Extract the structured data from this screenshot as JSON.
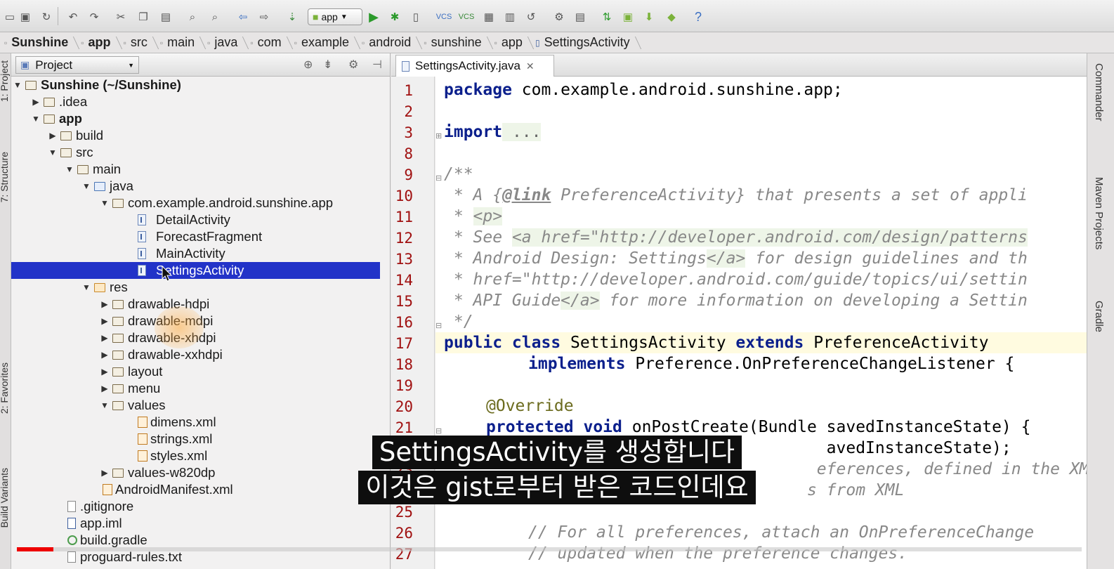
{
  "toolbar": {
    "run_config": "app"
  },
  "breadcrumbs": [
    "Sunshine",
    "app",
    "src",
    "main",
    "java",
    "com",
    "example",
    "android",
    "sunshine",
    "app",
    "SettingsActivity"
  ],
  "left_strip": {
    "project_tab": "1: Project",
    "structure_tab": "7: Structure",
    "favorites_tab": "2: Favorites",
    "build_variants_tab": "Build Variants"
  },
  "right_strip": {
    "commander_tab": "Commander",
    "maven_tab": "Maven Projects",
    "gradle_tab": "Gradle"
  },
  "project_panel": {
    "title": "Project"
  },
  "tree": [
    {
      "label": "Sunshine (~/Sunshine)",
      "arrow": "▼"
    },
    {
      "label": ".idea",
      "arrow": "▶"
    },
    {
      "label": "app",
      "arrow": "▼"
    },
    {
      "label": "build",
      "arrow": "▶"
    },
    {
      "label": "src",
      "arrow": "▼"
    },
    {
      "label": "main",
      "arrow": "▼"
    },
    {
      "label": "java",
      "arrow": "▼"
    },
    {
      "label": "com.example.android.sunshine.app",
      "arrow": "▼"
    },
    {
      "label": "DetailActivity",
      "arrow": ""
    },
    {
      "label": "ForecastFragment",
      "arrow": ""
    },
    {
      "label": "MainActivity",
      "arrow": ""
    },
    {
      "label": "SettingsActivity",
      "arrow": ""
    },
    {
      "label": "res",
      "arrow": "▼"
    },
    {
      "label": "drawable-hdpi",
      "arrow": "▶"
    },
    {
      "label": "drawable-mdpi",
      "arrow": "▶"
    },
    {
      "label": "drawable-xhdpi",
      "arrow": "▶"
    },
    {
      "label": "drawable-xxhdpi",
      "arrow": "▶"
    },
    {
      "label": "layout",
      "arrow": "▶"
    },
    {
      "label": "menu",
      "arrow": "▶"
    },
    {
      "label": "values",
      "arrow": "▼"
    },
    {
      "label": "dimens.xml",
      "arrow": ""
    },
    {
      "label": "strings.xml",
      "arrow": ""
    },
    {
      "label": "styles.xml",
      "arrow": ""
    },
    {
      "label": "values-w820dp",
      "arrow": "▶"
    },
    {
      "label": "AndroidManifest.xml",
      "arrow": ""
    },
    {
      "label": ".gitignore",
      "arrow": ""
    },
    {
      "label": "app.iml",
      "arrow": ""
    },
    {
      "label": "build.gradle",
      "arrow": ""
    },
    {
      "label": "proguard-rules.txt",
      "arrow": ""
    }
  ],
  "editor": {
    "tab_label": "SettingsActivity.java",
    "line_numbers": [
      "1",
      "2",
      "3",
      "8",
      "9",
      "10",
      "11",
      "12",
      "13",
      "14",
      "15",
      "16",
      "17",
      "18",
      "19",
      "20",
      "21",
      "22",
      "23",
      "24",
      "25",
      "26",
      "27"
    ]
  },
  "code": {
    "l1_kw": "package",
    "l1_rest": " com.example.android.sunshine.app;",
    "l3_kw": "import",
    "l3_rest": " ...",
    "l9": "/**",
    "l10_a": " * A {",
    "l10_link": "@link",
    "l10_b": " PreferenceActivity} that presents a set of appli",
    "l11_a": " * ",
    "l11_tag": "<p>",
    "l12_a": " * See ",
    "l12_tag": "<a href=\"http://developer.android.com/design/patterns",
    "l13_a": " * Android Design: Settings",
    "l13_tag": "</a>",
    "l13_b": " for design guidelines and th",
    "l14": " * href=\"http://developer.android.com/guide/topics/ui/settin",
    "l15_a": " * API Guide",
    "l15_tag": "</a>",
    "l15_b": " for more information on developing a Settin",
    "l16": " */",
    "l17_kw1": "public class",
    "l17_mid": " SettingsActivity ",
    "l17_kw2": "extends",
    "l17_end": " PreferenceActivity",
    "l18_kw": "implements",
    "l18_rest": " Preference.OnPreferenceChangeListener {",
    "l20": "@Override",
    "l21_kw": "protected void",
    "l21_rest": " onPostCreate(Bundle savedInstanceState) {",
    "l22": "                                   avedInstanceState);",
    "l23": "                                  eferences, defined in the XML fil",
    "l24": "                                 s from XML",
    "l26": "// For all preferences, attach an OnPreferenceChange",
    "l27": "// updated when the preference changes."
  },
  "subtitles": {
    "line1": "SettingsActivity를 생성합니다",
    "line2": "이것은 gist로부터 받은 코드인데요"
  },
  "video": {
    "progress": 0.034,
    "accent": "#ee0000"
  },
  "colors": {
    "selection": "#2233c8",
    "keyword": "#0b1f8c",
    "line_number": "#a01010"
  }
}
